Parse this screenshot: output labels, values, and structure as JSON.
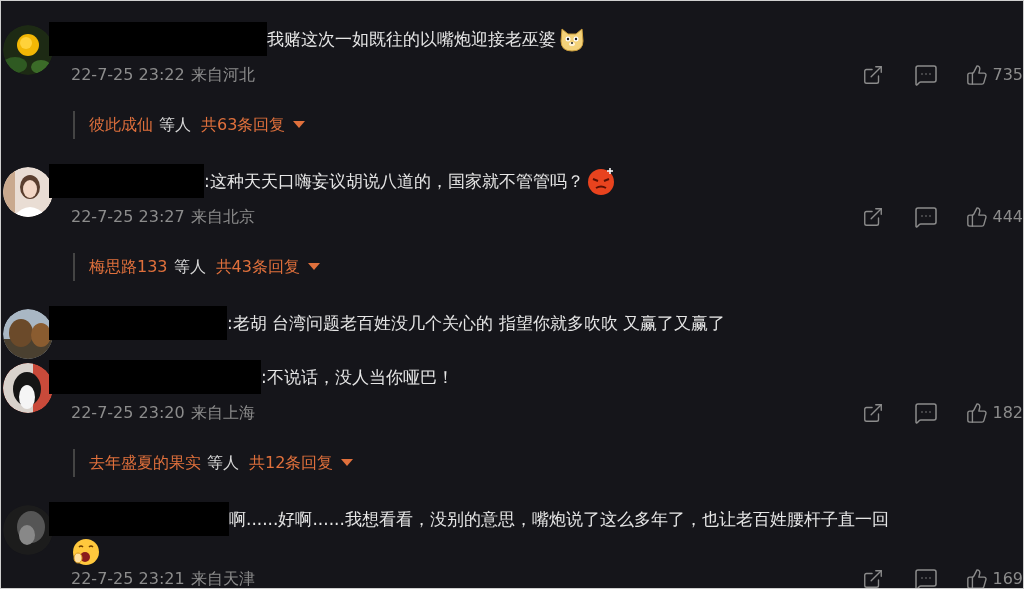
{
  "comments": [
    {
      "text": "我赌这次一如既往的以嘴炮迎接老巫婆",
      "emoji": {
        "kind": "dog"
      },
      "time": "22-7-25 23:22",
      "location": "来自河北",
      "likes": "735",
      "replies": {
        "names": "彼此成仙",
        "suffix": "等人",
        "total": "共63条回复"
      }
    },
    {
      "text": ":这种天天口嗨妄议胡说八道的，国家就不管管吗？",
      "emoji": {
        "kind": "angry"
      },
      "time": "22-7-25 23:27",
      "location": "来自北京",
      "likes": "444",
      "replies": {
        "names": "梅思路133",
        "suffix": "等人",
        "total": "共43条回复"
      }
    },
    {
      "text": ":老胡  台湾问题老百姓没几个关心的 指望你就多吹吹 又赢了又赢了"
    },
    {
      "text": ":不说话，没人当你哑巴！",
      "time": "22-7-25 23:20",
      "location": "来自上海",
      "likes": "182",
      "replies": {
        "names": "去年盛夏的果实",
        "suffix": "等人",
        "total": "共12条回复"
      }
    },
    {
      "text": "啊......好啊......我想看看，没别的意思，嘴炮说了这么多年了，也让老百姓腰杆子直一回",
      "emoji": {
        "kind": "yawn",
        "own_line": true
      },
      "time": "22-7-25 23:21",
      "location": "来自天津",
      "likes": "169"
    }
  ]
}
